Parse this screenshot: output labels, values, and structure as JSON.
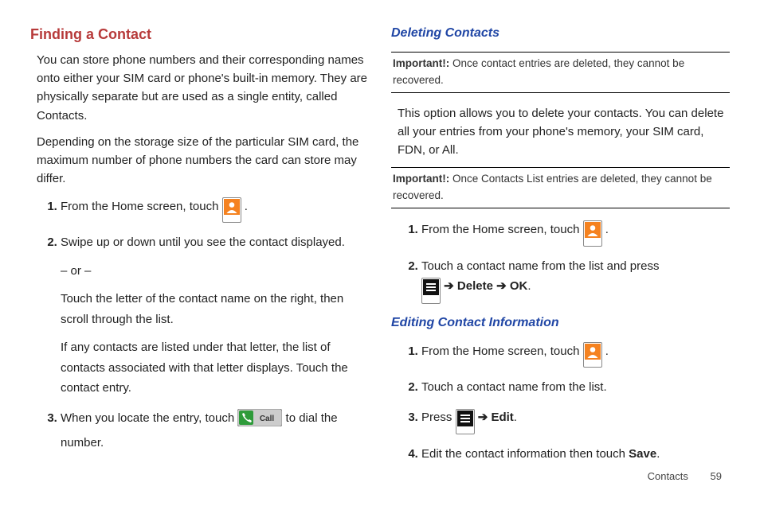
{
  "left": {
    "title": "Finding a Contact",
    "p1": "You can store phone numbers and their corresponding names onto either your SIM card or phone's built-in memory. They are physically separate but are used as a single entity, called Contacts.",
    "p2": "Depending on the storage size of the particular SIM card, the maximum number of phone numbers the card can store may differ.",
    "step1a": "From the Home screen, touch ",
    "step1b": " .",
    "step2a": "Swipe up or down until you see the contact displayed.",
    "step2or": "– or –",
    "step2b": "Touch the letter of the contact name on the right, then scroll through the list.",
    "step2c": "If any contacts are listed under that letter, the list of contacts associated with that letter displays. Touch the contact entry.",
    "step3a": "When you locate the entry, touch ",
    "step3b": " to dial the number."
  },
  "right": {
    "delTitle": "Deleting Contacts",
    "warn1": "Once contact entries are deleted, they cannot be recovered.",
    "warnLabel": "Important!:",
    "delP": "This option allows you to delete your contacts.  You can delete all your entries from your phone's memory, your SIM card, FDN, or All.",
    "warn2": "Once Contacts List entries are deleted, they cannot be recovered.",
    "d1a": "From the Home screen, touch ",
    "d1b": " .",
    "d2a": "Touch a contact name from the list and press ",
    "d2arrow1": " ➔ ",
    "d2del": "Delete",
    "d2arrow2": " ➔ ",
    "d2ok": "OK",
    "d2end": ".",
    "editTitle": "Editing Contact Information",
    "e1a": "From the Home screen, touch ",
    "e1b": " .",
    "e2": "Touch a contact name from the list.",
    "e3a": "Press ",
    "e3arrow": " ➔ ",
    "e3edit": "Edit",
    "e3end": ".",
    "e4a": "Edit the contact information then touch ",
    "e4save": "Save",
    "e4end": "."
  },
  "footer": {
    "section": "Contacts",
    "page": "59"
  },
  "icons": {
    "callLabel": "Call"
  }
}
